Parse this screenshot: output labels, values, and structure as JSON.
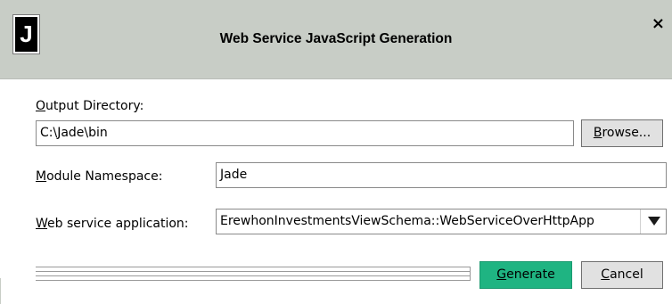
{
  "window": {
    "title": "Web Service JavaScript Generation",
    "logo_letter": "J",
    "close_glyph": "×"
  },
  "output_directory": {
    "label_mnemonic": "O",
    "label_rest": "utput Directory:",
    "value": "C:\\Jade\\bin",
    "browse_mnemonic": "B",
    "browse_rest": "rowse..."
  },
  "module_namespace": {
    "label_mnemonic": "M",
    "label_rest": "odule Namespace:",
    "value": "Jade"
  },
  "web_service_application": {
    "label_mnemonic": "W",
    "label_rest": "eb service application:",
    "selected": "ErewhonInvestmentsViewSchema::WebServiceOverHttpApp"
  },
  "actions": {
    "generate_mnemonic": "G",
    "generate_rest": "enerate",
    "cancel_mnemonic": "C",
    "cancel_rest": "ancel"
  },
  "progress": {
    "value": 0
  },
  "colors": {
    "titlebar": "#c8cdc6",
    "primary_button": "#1fb482"
  }
}
